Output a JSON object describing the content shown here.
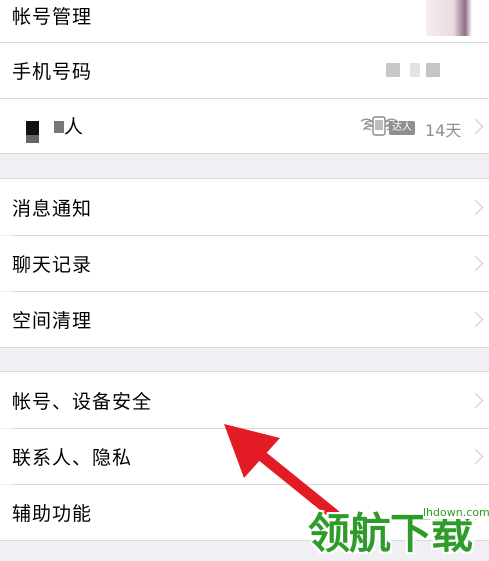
{
  "rows_group1": [
    {
      "label": "帐号管理"
    },
    {
      "label": "手机号码"
    },
    {
      "label": "人"
    }
  ],
  "talent_badge": "达人",
  "days": "14天",
  "rows_group2": [
    {
      "label": "消息通知"
    },
    {
      "label": "聊天记录"
    },
    {
      "label": "空间清理"
    }
  ],
  "rows_group3": [
    {
      "label": "帐号、设备安全"
    },
    {
      "label": "联系人、隐私"
    },
    {
      "label": "辅助功能"
    }
  ],
  "watermark": {
    "brand": "领航下载",
    "url": "lhdown.com"
  },
  "colors": {
    "page_bg": "#efeff4",
    "arrow": "#e21b25",
    "watermark_green": "#2e9b2a"
  }
}
